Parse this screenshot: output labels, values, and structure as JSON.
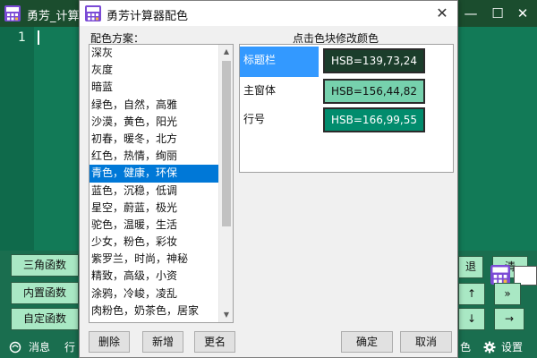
{
  "main_window": {
    "title": "勇芳_计算器",
    "line_number": "1",
    "controls": {
      "minimize": "—",
      "maximize": "☐",
      "close": "✕"
    },
    "left_buttons": [
      "三角函数",
      "内置函数",
      "自定函数"
    ],
    "right_buttons": {
      "back": "退",
      "clear": "清",
      "up": "↑",
      "expand": "»",
      "down": "↓",
      "right": "→"
    },
    "status": {
      "message": "消息",
      "row": "行",
      "color": "色",
      "settings": "设置"
    }
  },
  "dialog": {
    "title": "勇芳计算器配色",
    "close": "✕",
    "scheme_label": "配色方案：",
    "hint": "点击色块修改颜色",
    "schemes": [
      "深灰",
      "灰度",
      "暗蓝",
      "绿色，自然，高雅",
      "沙漠，黄色，阳光",
      "初春，暖冬，北方",
      "红色，热情，绚丽",
      "青色，健康，环保",
      "蓝色，沉稳，低调",
      "星空，蔚蓝，极光",
      "驼色，温暖，生活",
      "少女，粉色，彩妆",
      "紫罗兰，时尚，神秘",
      "精致，高级，小资",
      "涂鸦，冷峻，凌乱",
      "肉粉色，奶茶色，居家"
    ],
    "selected_scheme": "青色，健康，环保",
    "preview": [
      {
        "label": "标题栏",
        "value": "HSB=139,73,24",
        "color": "#1b3d2b",
        "text_color": "#ffffff"
      },
      {
        "label": "主窗体",
        "value": "HSB=156,44,82",
        "color": "#76d1ad",
        "text_color": "#111111"
      },
      {
        "label": "行号",
        "value": "HSB=166,99,55",
        "color": "#018c6d",
        "text_color": "#ffffff"
      }
    ],
    "buttons": {
      "delete": "删除",
      "new": "新增",
      "rename": "更名",
      "ok": "确定",
      "cancel": "取消"
    }
  }
}
